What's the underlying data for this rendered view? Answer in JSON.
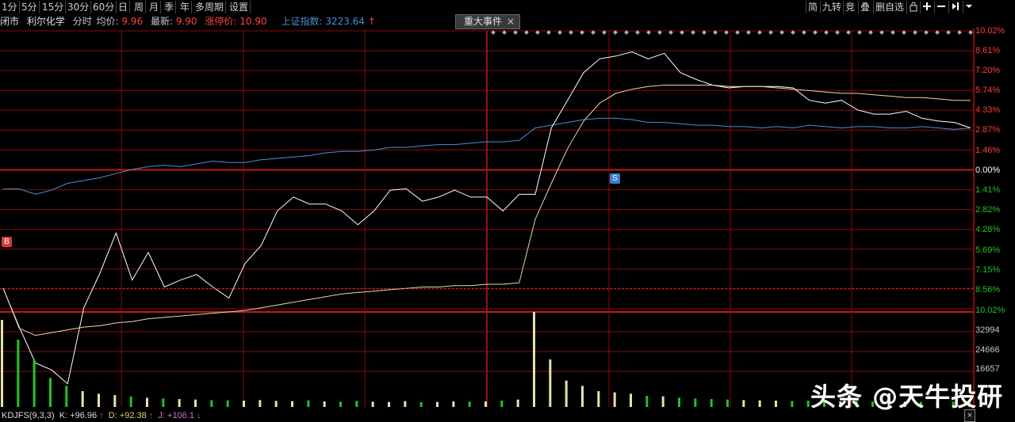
{
  "toolbar": {
    "timeframes": [
      "1分",
      "5分",
      "15分",
      "30分",
      "60分",
      "日",
      "周",
      "月",
      "季",
      "年",
      "多周期",
      "设置"
    ],
    "right_buttons": [
      "简",
      "九转",
      "竞",
      "叠",
      "删自选"
    ],
    "right_icons": [
      "lock-icon",
      "plus-icon",
      "minus-icon",
      "pin-icon",
      "dropdown-icon"
    ]
  },
  "info": {
    "status": "闭市",
    "stock": "利尔化学",
    "mode": "分时",
    "avg_label": "均价:",
    "avg_value": "9.96",
    "last_label": "最新:",
    "last_value": "9.90",
    "limit_label": "涨停价:",
    "limit_value": "10.90",
    "index_label": "上证指数:",
    "index_value": "3223.64",
    "index_arrow": "↑"
  },
  "event_tab": {
    "label": "重大事件",
    "close": "×"
  },
  "right_axis": {
    "price_labels": [
      "10.02%",
      "8.61%",
      "7.20%",
      "5.74%",
      "4.33%",
      "2.87%",
      "1.46%",
      "0.00%",
      "1.41%",
      "2.82%",
      "4.28%",
      "5.69%",
      "7.15%",
      "8.56%",
      "10.02%"
    ],
    "volume_labels": [
      "32994",
      "24666",
      "16657"
    ]
  },
  "markers": {
    "buy": "B",
    "sell": "S"
  },
  "indicator": {
    "name": "KDJFS(9,3,3)",
    "k_label": "K:",
    "k_value": "+96.96",
    "k_arrow": "↑",
    "d_label": "D:",
    "d_value": "+92.38",
    "d_arrow": "↑",
    "j_label": "J:",
    "j_value": "+106.1",
    "j_arrow": "↓"
  },
  "watermark": "头条 @天牛投研",
  "scroll_icon": "×",
  "colors": {
    "up": "#ff3b3b",
    "down": "#22c322",
    "index_line": "#4a8fd4",
    "price_line": "#ffffff",
    "avg_line": "#e8d9a8",
    "grid": "#8a0a0a",
    "zero_line": "#c01818"
  },
  "chart_data": {
    "type": "line",
    "title": "",
    "series": [
      {
        "name": "",
        "values": [
          -1.41,
          -1.41,
          -1.8,
          -1.5,
          -1.0,
          -0.8,
          -0.6,
          -0.3,
          0.0,
          0.2,
          0.3,
          0.2,
          0.4,
          0.6,
          0.5,
          0.5,
          0.7,
          0.8,
          0.9,
          1.0,
          1.2,
          1.3,
          1.3,
          1.4,
          1.6,
          1.6,
          1.7,
          1.8,
          1.8,
          1.9,
          2.0,
          2.0,
          2.1,
          3.0,
          3.2,
          3.4,
          3.6,
          3.7,
          3.7,
          3.6,
          3.4,
          3.4,
          3.3,
          3.2,
          3.2,
          3.1,
          3.1,
          3.0,
          3.1,
          3.0,
          3.2,
          3.1,
          3.0,
          3.1,
          3.1,
          3.0,
          3.0,
          3.1,
          3.0,
          2.9,
          3.0
        ]
      },
      {
        "name": "",
        "values": [
          -8.6,
          -11.4,
          -14.0,
          -14.5,
          -15.5,
          -10.0,
          -7.5,
          -4.6,
          -8.0,
          -6.0,
          -8.5,
          -8.0,
          -7.6,
          -8.5,
          -9.3,
          -6.8,
          -5.5,
          -3.0,
          -2.0,
          -2.5,
          -2.5,
          -3.0,
          -4.0,
          -3.0,
          -1.5,
          -1.4,
          -2.3,
          -2.0,
          -1.5,
          -2.0,
          -2.0,
          -3.0,
          -1.8,
          -1.8,
          3.0,
          5.0,
          7.0,
          8.0,
          8.2,
          8.5,
          8.0,
          8.4,
          7.0,
          6.5,
          6.1,
          5.9,
          6.0,
          6.0,
          6.0,
          5.9,
          5.0,
          4.8,
          5.0,
          4.3,
          4.0,
          4.0,
          4.2,
          3.7,
          3.5,
          3.4,
          3.0
        ]
      },
      {
        "name": "",
        "values": [
          -8.6,
          -11.5,
          -12.0,
          -11.8,
          -11.6,
          -11.4,
          -11.3,
          -11.1,
          -11.0,
          -10.8,
          -10.7,
          -10.6,
          -10.5,
          -10.4,
          -10.3,
          -10.2,
          -10.0,
          -9.8,
          -9.6,
          -9.4,
          -9.2,
          -9.0,
          -8.9,
          -8.8,
          -8.7,
          -8.6,
          -8.5,
          -8.5,
          -8.4,
          -8.4,
          -8.3,
          -8.3,
          -8.2,
          -3.6,
          -1.0,
          1.5,
          3.5,
          4.8,
          5.5,
          5.8,
          6.0,
          6.1,
          6.1,
          6.1,
          6.1,
          6.0,
          6.0,
          6.0,
          5.9,
          5.8,
          5.7,
          5.6,
          5.5,
          5.5,
          5.4,
          5.3,
          5.2,
          5.2,
          5.1,
          5.0,
          5.0
        ]
      }
    ],
    "volume": [
      32994,
      25500,
      18000,
      11000,
      8000,
      6000,
      5000,
      4500,
      4000,
      3500,
      3200,
      3000,
      2800,
      2600,
      2500,
      2400,
      2600,
      2300,
      2200,
      2500,
      2100,
      2000,
      2300,
      2000,
      1900,
      2200,
      1800,
      1900,
      2100,
      2000,
      2100,
      2400,
      2800,
      36000,
      18000,
      10000,
      8000,
      6000,
      5500,
      5000,
      4200,
      4000,
      3500,
      3200,
      3000,
      2800,
      2600,
      2500,
      2400,
      2300,
      2400,
      2200,
      2100,
      2300,
      2000,
      2100,
      2000,
      1900,
      1800,
      2000,
      2200
    ],
    "ylim_pct": [
      -10.02,
      10.02
    ]
  }
}
